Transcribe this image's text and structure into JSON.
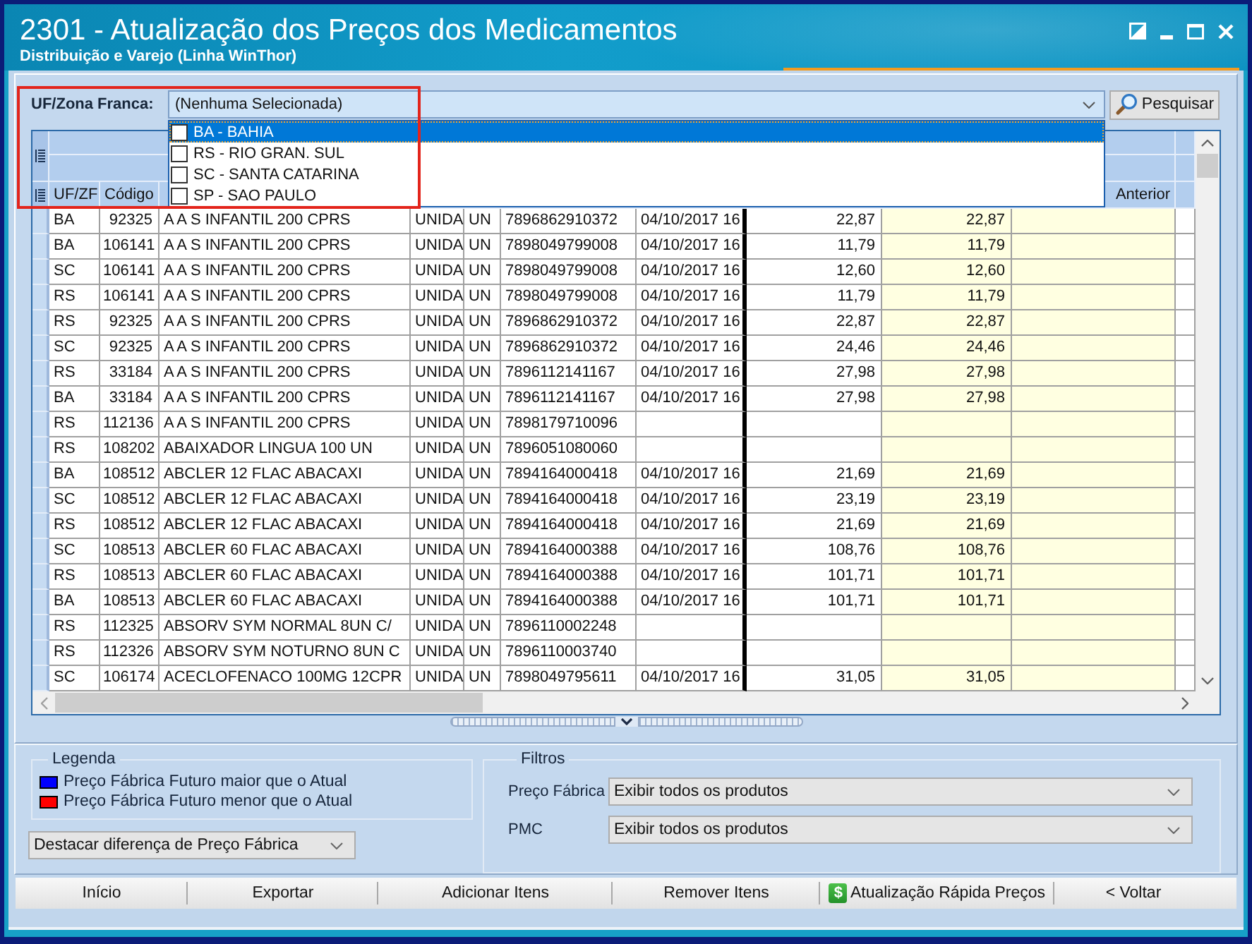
{
  "window": {
    "title": "2301 - Atualização dos Preços dos Medicamentos",
    "subtitle": "Distribuição e Varejo (Linha WinThor)"
  },
  "uf_filter": {
    "label": "UF/Zona Franca:",
    "value": "(Nenhuma Selecionada)",
    "expanded": true,
    "options": [
      {
        "label": "BA - BAHIA",
        "checked": false,
        "selected": true
      },
      {
        "label": "RS - RIO GRAN. SUL",
        "checked": false,
        "selected": false
      },
      {
        "label": "SC - SANTA CATARINA",
        "checked": false,
        "selected": false
      },
      {
        "label": "SP - SAO PAULO",
        "checked": false,
        "selected": false
      }
    ],
    "search_button": "Pesquisar"
  },
  "table": {
    "column_headers": {
      "column_1": "UF/ZF",
      "column_2": "Código",
      "column_10": "Anterior"
    },
    "rows": [
      {
        "column_1": "BA",
        "column_2": "92325",
        "column_3": "A A S INFANTIL 200 CPRS",
        "column_4": "UNIDA",
        "column_5": "UN",
        "column_6": "7896862910372",
        "column_7": "04/10/2017 16",
        "column_8": "22,87",
        "column_9": "22,87"
      },
      {
        "column_1": "BA",
        "column_2": "106141",
        "column_3": "A A S INFANTIL 200 CPRS",
        "column_4": "UNIDA",
        "column_5": "UN",
        "column_6": "7898049799008",
        "column_7": "04/10/2017 16",
        "column_8": "11,79",
        "column_9": "11,79"
      },
      {
        "column_1": "SC",
        "column_2": "106141",
        "column_3": "A A S INFANTIL 200 CPRS",
        "column_4": "UNIDA",
        "column_5": "UN",
        "column_6": "7898049799008",
        "column_7": "04/10/2017 16",
        "column_8": "12,60",
        "column_9": "12,60"
      },
      {
        "column_1": "RS",
        "column_2": "106141",
        "column_3": "A A S INFANTIL 200 CPRS",
        "column_4": "UNIDA",
        "column_5": "UN",
        "column_6": "7898049799008",
        "column_7": "04/10/2017 16",
        "column_8": "11,79",
        "column_9": "11,79"
      },
      {
        "column_1": "RS",
        "column_2": "92325",
        "column_3": "A A S INFANTIL 200 CPRS",
        "column_4": "UNIDA",
        "column_5": "UN",
        "column_6": "7896862910372",
        "column_7": "04/10/2017 16",
        "column_8": "22,87",
        "column_9": "22,87"
      },
      {
        "column_1": "SC",
        "column_2": "92325",
        "column_3": "A A S INFANTIL 200 CPRS",
        "column_4": "UNIDA",
        "column_5": "UN",
        "column_6": "7896862910372",
        "column_7": "04/10/2017 16",
        "column_8": "24,46",
        "column_9": "24,46"
      },
      {
        "column_1": "RS",
        "column_2": "33184",
        "column_3": "A A S INFANTIL 200 CPRS",
        "column_4": "UNIDA",
        "column_5": "UN",
        "column_6": "7896112141167",
        "column_7": "04/10/2017 16",
        "column_8": "27,98",
        "column_9": "27,98"
      },
      {
        "column_1": "BA",
        "column_2": "33184",
        "column_3": "A A S INFANTIL 200 CPRS",
        "column_4": "UNIDA",
        "column_5": "UN",
        "column_6": "7896112141167",
        "column_7": "04/10/2017 16",
        "column_8": "27,98",
        "column_9": "27,98"
      },
      {
        "column_1": "RS",
        "column_2": "112136",
        "column_3": "A A S INFANTIL 200 CPRS",
        "column_4": "UNIDA",
        "column_5": "UN",
        "column_6": "7898179710096"
      },
      {
        "column_1": "RS",
        "column_2": "108202",
        "column_3": "ABAIXADOR LINGUA 100 UN",
        "column_4": "UNIDA",
        "column_5": "UN",
        "column_6": "7896051080060"
      },
      {
        "column_1": "BA",
        "column_2": "108512",
        "column_3": "ABCLER 12 FLAC ABACAXI",
        "column_4": "UNIDA",
        "column_5": "UN",
        "column_6": "7894164000418",
        "column_7": "04/10/2017 16",
        "column_8": "21,69",
        "column_9": "21,69"
      },
      {
        "column_1": "SC",
        "column_2": "108512",
        "column_3": "ABCLER 12 FLAC ABACAXI",
        "column_4": "UNIDA",
        "column_5": "UN",
        "column_6": "7894164000418",
        "column_7": "04/10/2017 16",
        "column_8": "23,19",
        "column_9": "23,19"
      },
      {
        "column_1": "RS",
        "column_2": "108512",
        "column_3": "ABCLER 12 FLAC ABACAXI",
        "column_4": "UNIDA",
        "column_5": "UN",
        "column_6": "7894164000418",
        "column_7": "04/10/2017 16",
        "column_8": "21,69",
        "column_9": "21,69"
      },
      {
        "column_1": "SC",
        "column_2": "108513",
        "column_3": "ABCLER 60 FLAC ABACAXI",
        "column_4": "UNIDA",
        "column_5": "UN",
        "column_6": "7894164000388",
        "column_7": "04/10/2017 16",
        "column_8": "108,76",
        "column_9": "108,76"
      },
      {
        "column_1": "RS",
        "column_2": "108513",
        "column_3": "ABCLER 60 FLAC ABACAXI",
        "column_4": "UNIDA",
        "column_5": "UN",
        "column_6": "7894164000388",
        "column_7": "04/10/2017 16",
        "column_8": "101,71",
        "column_9": "101,71"
      },
      {
        "column_1": "BA",
        "column_2": "108513",
        "column_3": "ABCLER 60 FLAC ABACAXI",
        "column_4": "UNIDA",
        "column_5": "UN",
        "column_6": "7894164000388",
        "column_7": "04/10/2017 16",
        "column_8": "101,71",
        "column_9": "101,71"
      },
      {
        "column_1": "RS",
        "column_2": "112325",
        "column_3": "ABSORV SYM NORMAL 8UN C/",
        "column_4": "UNIDA",
        "column_5": "UN",
        "column_6": "7896110002248"
      },
      {
        "column_1": "RS",
        "column_2": "112326",
        "column_3": "ABSORV SYM NOTURNO 8UN C",
        "column_4": "UNIDA",
        "column_5": "UN",
        "column_6": "7896110003740"
      },
      {
        "column_1": "SC",
        "column_2": "106174",
        "column_3": "ACECLOFENACO 100MG 12CPR",
        "column_4": "UNIDA",
        "column_5": "UN",
        "column_6": "7898049795611",
        "column_7": "04/10/2017 16",
        "column_8": "31,05",
        "column_9": "31,05"
      }
    ]
  },
  "legend": {
    "title": "Legenda",
    "items": [
      {
        "label": "Preço Fábrica Futuro maior que o Atual",
        "color": "#0000ff"
      },
      {
        "label": "Preço Fábrica Futuro menor que o Atual",
        "color": "#ff0000"
      }
    ]
  },
  "highlight_select": {
    "value": "Destacar diferença de Preço Fábrica"
  },
  "filters": {
    "title": "Filtros",
    "fields": [
      {
        "label": "Preço Fábrica",
        "value": "Exibir todos os produtos"
      },
      {
        "label": "PMC",
        "value": "Exibir todos os produtos"
      }
    ]
  },
  "buttons": [
    {
      "label": "Início",
      "kind": "plain"
    },
    {
      "label": "Exportar",
      "kind": "plain"
    },
    {
      "label": "Adicionar Itens",
      "kind": "plain"
    },
    {
      "label": "Remover Itens",
      "kind": "plain"
    },
    {
      "label": "Atualização Rápida Preços",
      "kind": "icon",
      "icon": "$"
    },
    {
      "label": "< Voltar",
      "kind": "plain"
    }
  ]
}
